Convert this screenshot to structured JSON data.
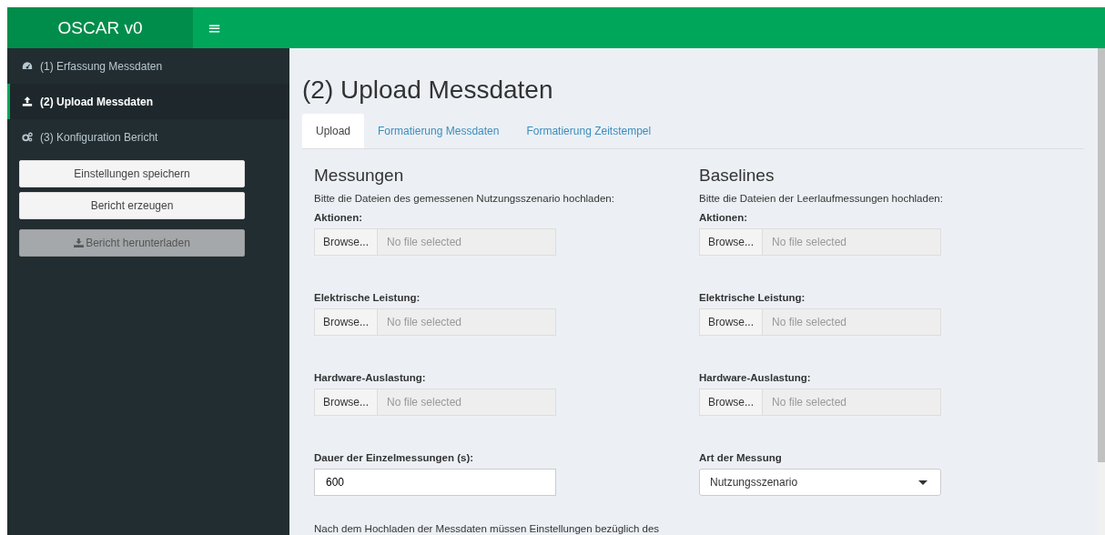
{
  "header": {
    "logo": "OSCAR v0",
    "menu_toggle": "≡"
  },
  "sidebar": {
    "items": [
      {
        "label": "(1) Erfassung Messdaten",
        "selected": false
      },
      {
        "label": "(2) Upload Messdaten",
        "selected": true
      },
      {
        "label": "(3) Konfiguration Bericht",
        "selected": false
      }
    ],
    "buttons": [
      {
        "label": "Einstellungen speichern",
        "kind": "action",
        "disabled": false
      },
      {
        "label": "Bericht erzeugen",
        "kind": "action",
        "disabled": false
      },
      {
        "label": "Bericht herunterladen",
        "kind": "download",
        "disabled": true
      }
    ]
  },
  "page": {
    "title": "(2) Upload Messdaten",
    "tabs": [
      {
        "label": "Upload",
        "selected": true
      },
      {
        "label": "Formatierung Messdaten",
        "selected": false
      },
      {
        "label": "Formatierung Zeitstempel",
        "selected": false
      }
    ],
    "columns": [
      {
        "heading": "Messungen",
        "description": "Bitte die Dateien des gemessenen Nutzungsszenario hochladen:",
        "fields": [
          {
            "kind": "file",
            "label": "Aktionen:",
            "button": "Browse...",
            "placeholder": "No file selected"
          },
          {
            "kind": "file",
            "label": "Elektrische Leistung:",
            "button": "Browse...",
            "placeholder": "No file selected"
          },
          {
            "kind": "file",
            "label": "Hardware-Auslastung:",
            "button": "Browse...",
            "placeholder": "No file selected"
          },
          {
            "kind": "number",
            "label": "Dauer der Einzelmessungen (s):",
            "value": "600"
          }
        ],
        "note": "Nach dem Hochladen der Messdaten müssen Einstellungen bezüglich des"
      },
      {
        "heading": "Baselines",
        "description": "Bitte die Dateien der Leerlaufmessungen hochladen:",
        "fields": [
          {
            "kind": "file",
            "label": "Aktionen:",
            "button": "Browse...",
            "placeholder": "No file selected"
          },
          {
            "kind": "file",
            "label": "Elektrische Leistung:",
            "button": "Browse...",
            "placeholder": "No file selected"
          },
          {
            "kind": "file",
            "label": "Hardware-Auslastung:",
            "button": "Browse...",
            "placeholder": "No file selected"
          },
          {
            "kind": "select",
            "label": "Art der Messung",
            "value": "Nutzungsszenario"
          }
        ]
      }
    ]
  }
}
